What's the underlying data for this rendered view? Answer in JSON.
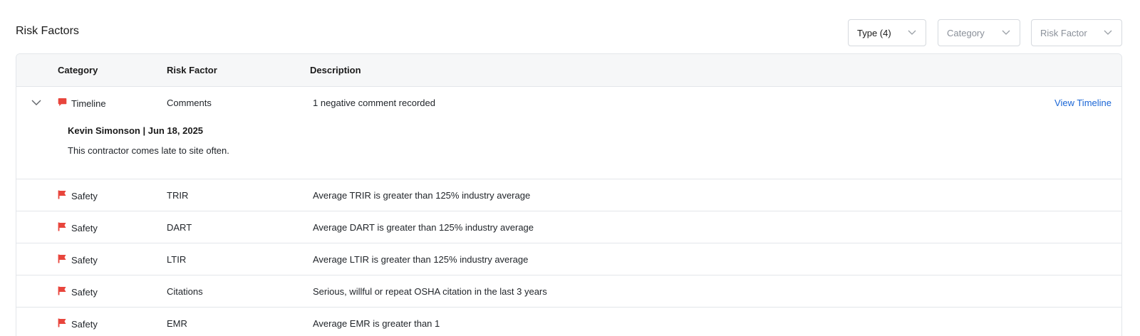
{
  "section": {
    "title": "Risk Factors"
  },
  "filters": [
    {
      "label": "Type (4)",
      "is_placeholder": false
    },
    {
      "label": "Category",
      "is_placeholder": true
    },
    {
      "label": "Risk Factor",
      "is_placeholder": true
    }
  ],
  "table": {
    "columns": [
      "Category",
      "Risk Factor",
      "Description"
    ],
    "expanded_row": {
      "category": "Timeline",
      "category_icon": "comment-icon",
      "risk_factor": "Comments",
      "description": "1 negative comment recorded",
      "action": "View Timeline",
      "comment": {
        "author_date": "Kevin Simonson | Jun 18, 2025",
        "text": "This contractor comes late to site often."
      }
    },
    "rows": [
      {
        "category": "Safety",
        "category_icon": "flag-icon",
        "risk_factor": "TRIR",
        "description": "Average TRIR is greater than 125% industry average"
      },
      {
        "category": "Safety",
        "category_icon": "flag-icon",
        "risk_factor": "DART",
        "description": "Average DART is greater than 125% industry average"
      },
      {
        "category": "Safety",
        "category_icon": "flag-icon",
        "risk_factor": "LTIR",
        "description": "Average LTIR is greater than 125% industry average"
      },
      {
        "category": "Safety",
        "category_icon": "flag-icon",
        "risk_factor": "Citations",
        "description": "Serious, willful or repeat OSHA citation in the last 3 years"
      },
      {
        "category": "Safety",
        "category_icon": "flag-icon",
        "risk_factor": "EMR",
        "description": "Average EMR is greater than 1"
      }
    ]
  },
  "colors": {
    "icon_red": "#e8453c",
    "link_blue": "#1a66d6",
    "header_bg": "#f6f7f8",
    "border": "#e3e6ea"
  }
}
